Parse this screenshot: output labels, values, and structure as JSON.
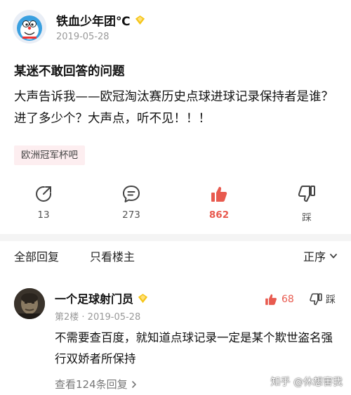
{
  "post": {
    "author": "铁血少年团℃",
    "date": "2019-05-28",
    "title": "某迷不敢回答的问题",
    "body": "大声告诉我——欧冠淘汰赛历史点球进球记录保持者是谁？进了多少个？大声点，听不见！！！",
    "tag": "欧洲冠军杯吧"
  },
  "actions": {
    "share_count": "13",
    "comment_count": "273",
    "like_count": "862",
    "dislike_label": "踩"
  },
  "reply_tabs": {
    "all": "全部回复",
    "op_only": "只看楼主",
    "sort": "正序"
  },
  "reply": {
    "author": "一个足球射门员",
    "meta": "第2楼 · 2019-05-28",
    "like_count": "68",
    "dislike_label": "踩",
    "text": "不需要查百度，就知道点球记录一定是某个欺世盗名强行双娇者所保持",
    "view_replies": "查看124条回复"
  },
  "watermark": "知乎 @休想害我",
  "colors": {
    "accent_red": "#e85a4f",
    "tag_bg": "#fdeef0",
    "badge_gold": "#f5c518"
  }
}
